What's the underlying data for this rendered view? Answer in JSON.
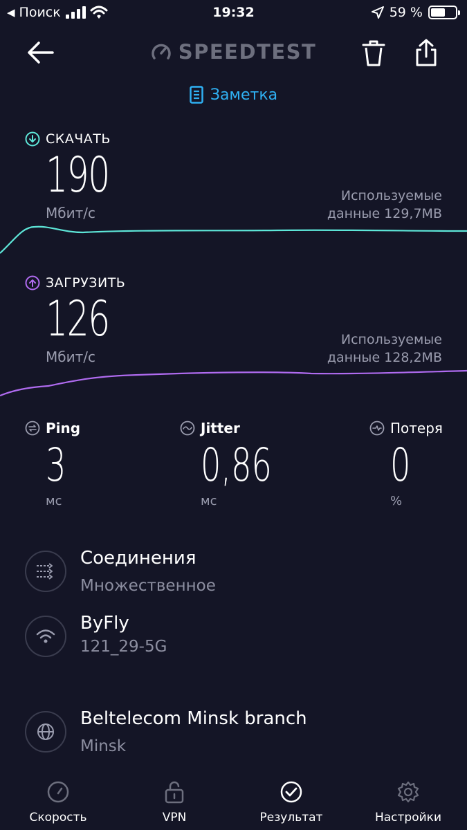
{
  "status_bar": {
    "back_label": "Поиск",
    "time": "19:32",
    "battery_text": "59 %",
    "battery_level": 0.59
  },
  "header": {
    "logo_text": "SPEEDTEST"
  },
  "note": {
    "label": "Заметка"
  },
  "download": {
    "label": "СКАЧАТЬ",
    "value": "190",
    "unit": "Мбит/с",
    "used_line1": "Используемые",
    "used_line2": "данные 129,7MB",
    "color": "#5ee7d9"
  },
  "upload": {
    "label": "ЗАГРУЗИТЬ",
    "value": "126",
    "unit": "Мбит/с",
    "used_line1": "Используемые",
    "used_line2": "данные 128,2MB",
    "color": "#b06bf0"
  },
  "stats": {
    "ping": {
      "label": "Ping",
      "value": "3",
      "unit": "мс"
    },
    "jitter": {
      "label": "Jitter",
      "value": "0,86",
      "unit": "мс"
    },
    "loss": {
      "label": "Потеря",
      "value": "0",
      "unit": "%"
    }
  },
  "info": {
    "connections": {
      "title": "Соединения",
      "subtitle": "Множественное"
    },
    "network": {
      "title": "ByFly",
      "subtitle": "121_29-5G"
    },
    "server": {
      "title": "Beltelecom Minsk branch",
      "subtitle": "Minsk"
    }
  },
  "tabs": [
    {
      "label": "Скорость",
      "icon": "gauge-icon"
    },
    {
      "label": "VPN",
      "icon": "lock-icon"
    },
    {
      "label": "Результат",
      "icon": "check-circle-icon"
    },
    {
      "label": "Настройки",
      "icon": "gear-icon"
    }
  ]
}
